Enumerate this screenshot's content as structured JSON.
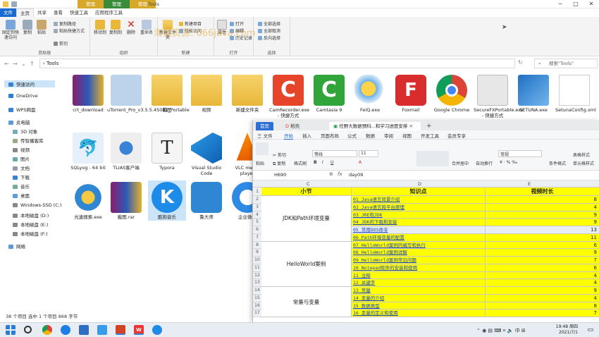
{
  "explorer": {
    "context_tabs": [
      "管理",
      "管理",
      "管理"
    ],
    "window_title": "Tools",
    "ribbon_tabs": [
      "文件",
      "主页",
      "共享",
      "查看",
      "快速工具",
      "应用程序工具"
    ],
    "ribbon": {
      "clipboard": {
        "pin": "固定到快速访问",
        "copy": "复制",
        "paste": "粘贴",
        "copy_path": "复制路径",
        "paste_shortcut": "粘贴快捷方式",
        "cut": "剪切",
        "label": "剪贴板"
      },
      "organize": {
        "move_to": "移动到",
        "copy_to": "复制到",
        "delete": "删除",
        "rename": "重命名",
        "label": "组织"
      },
      "new": {
        "new_folder": "新建文件夹",
        "new_item": "新建项目",
        "easy_access": "轻松访问",
        "label": "新建"
      },
      "open": {
        "properties": "属性",
        "open": "打开",
        "edit": "编辑",
        "history": "历史记录",
        "label": "打开"
      },
      "select": {
        "select_all": "全部选择",
        "select_none": "全部取消",
        "invert": "反向选择",
        "label": "选择"
      }
    },
    "watermark": "海量资源: 666java.com",
    "path": "Tools",
    "search_placeholder": "搜索\"Tools\"",
    "nav": [
      "快速访问",
      "OneDrive",
      "WPS网盘",
      "此电脑",
      "3D 对象",
      "传智播客库",
      "视频",
      "图片",
      "文档",
      "下载",
      "音乐",
      "桌面",
      "Windows-SSD (C:)",
      "本地磁盘 (D:)",
      "本地磁盘 (E:)",
      "本地磁盘 (F:)",
      "网络"
    ],
    "files_row1": [
      "crt_download",
      "uTorrent_Pro_v3.5.5.45081_Portable",
      "截图",
      "视频",
      "新建文件夹",
      "CamRecorder.exe - 快捷方式",
      "Camtasia 9",
      "FeiQ.exe",
      "Foxmail",
      "Google Chrome",
      "SecureFXPortable.exe - 快捷方式",
      "SETUNA.exe",
      "SetunaConfig.xml"
    ],
    "files_row2": [
      "SQLyog - 64 bit",
      "TLIAS客户端",
      "Typora",
      "Visual Studio Code",
      "VLC media player"
    ],
    "files_row3": [
      "光速搜索.exe",
      "截图.rar",
      "酷狗音乐",
      "鲁大师",
      "企业微信"
    ],
    "status": "38 个项目    选中 1 个项目  868 字节"
  },
  "wps": {
    "tabs": [
      "首页",
      "稻壳",
      "任野大数据预科...和学习进度安排"
    ],
    "menu": [
      "三 文件",
      "开始",
      "插入",
      "页面布局",
      "公式",
      "数据",
      "审阅",
      "视图",
      "开发工具",
      "会员专享"
    ],
    "toolbar": {
      "cut": "剪切",
      "copy": "复制",
      "format_painter": "格式刷",
      "paste": "粘贴",
      "font": "等线",
      "size": "11",
      "merge": "合并居中",
      "wrap": "自动换行",
      "style": "常规",
      "cond_format": "条件格式",
      "table_style": "表格样式",
      "cell_style": "单元格样式"
    },
    "name_box": "H690",
    "formula": "day09",
    "columns": [
      "C",
      "D",
      "E"
    ],
    "header": {
      "c": "小节",
      "d": "知识点",
      "e": "视频时长"
    },
    "groups": [
      {
        "label": "JDK和Path环境变量",
        "start": 0,
        "span": 6
      },
      {
        "label": "HelloWorld案例",
        "start": 6,
        "span": 6
      },
      {
        "label": "常量与变量",
        "start": 12,
        "span": 4
      }
    ],
    "rows": [
      {
        "n": "2",
        "d": "01_Java语言背景介绍",
        "e": "8"
      },
      {
        "n": "3",
        "d": "02_Java语言跨平台原理",
        "e": "4"
      },
      {
        "n": "4",
        "d": "03_JRE和JDK",
        "e": "9"
      },
      {
        "n": "5",
        "d": "04_JDK的下载和安装",
        "e": "9"
      },
      {
        "n": "6",
        "d": "05_常用DOS命令",
        "e": "13"
      },
      {
        "n": "7",
        "d": "06_Path环境变量的配置",
        "e": "11"
      },
      {
        "n": "8",
        "d": "07_HelloWorld案例的编写和执行",
        "e": "6"
      },
      {
        "n": "9",
        "d": "08_HelloWorld案例详解",
        "e": "9"
      },
      {
        "n": "10",
        "d": "09_HelloWorld案例常见问题",
        "e": "7"
      },
      {
        "n": "11",
        "d": "10_Notepad软件的安装和使用",
        "e": "6"
      },
      {
        "n": "12",
        "d": "11_注释",
        "e": "4"
      },
      {
        "n": "13",
        "d": "12_关键字",
        "e": "4"
      },
      {
        "n": "14",
        "d": "13_常量",
        "e": "9"
      },
      {
        "n": "15",
        "d": "14_变量的介绍",
        "e": "4"
      },
      {
        "n": "16",
        "d": "15_数据类型",
        "e": "8"
      },
      {
        "n": "17",
        "d": "16_变量的定义和使用",
        "e": "7"
      }
    ],
    "selected_row": 4
  },
  "taskbar": {
    "time": "19:48 周四",
    "date": "2021/7/1"
  }
}
